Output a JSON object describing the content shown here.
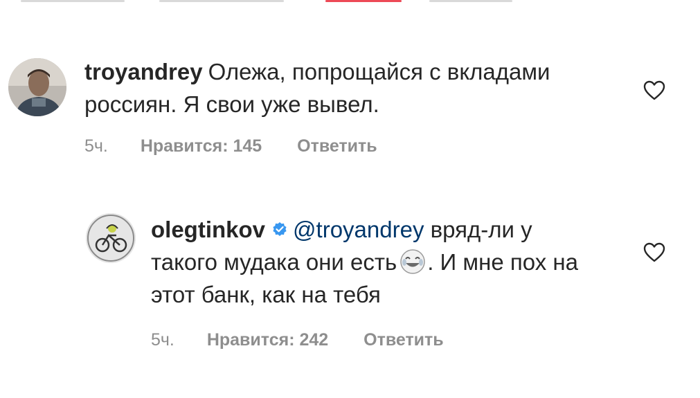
{
  "comments": [
    {
      "username": "troyandrey",
      "text": "Олежа, попрощайся с вкладами россиян. Я свои уже вывел.",
      "time": "5ч.",
      "likes": "Нравится: 145",
      "reply": "Ответить",
      "avatar": "user-photo-avatar"
    },
    {
      "username": "olegtinkov",
      "verified": true,
      "mention": "@troyandrey",
      "text_before_emoji": "вряд-ли у такого мудака они есть",
      "emoji": "tears-of-joy-emoji",
      "text_after_emoji": ". И мне пох на этот банк, как на тебя",
      "time": "5ч.",
      "likes": "Нравится: 242",
      "reply": "Ответить",
      "avatar": "logo-avatar"
    }
  ],
  "colors": {
    "text": "#262626",
    "meta": "#8e8e8e",
    "mention": "#00376b",
    "verified": "#3897f0",
    "heart_outline": "#262626"
  }
}
